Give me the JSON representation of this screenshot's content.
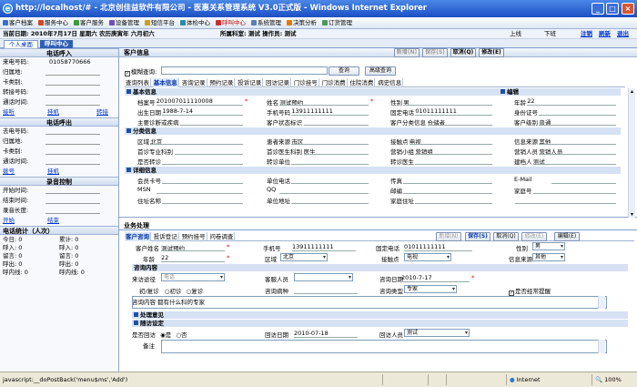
{
  "window": {
    "title": "http://localhost/# - 北京创佳益软件有限公司 - 医惠关系管理系统 V3.0正式版 - Windows Internet Explorer"
  },
  "menu": {
    "items": [
      {
        "label": "客户档案",
        "color": "#3a6ed0"
      },
      {
        "label": "服务中心",
        "color": "#d2462e"
      },
      {
        "label": "客户服务",
        "color": "#3a9a3a"
      },
      {
        "label": "设备管理",
        "color": "#6b4fc0"
      },
      {
        "label": "短信平台",
        "color": "#c9a020"
      },
      {
        "label": "体检中心",
        "color": "#2a8aa8"
      },
      {
        "label": "呼叫中心",
        "color": "#c83030"
      },
      {
        "label": "系统管理",
        "color": "#5a7fb0"
      },
      {
        "label": "决策分析",
        "color": "#e07a10"
      },
      {
        "label": "订货管理",
        "color": "#4a9a5a"
      }
    ]
  },
  "info": {
    "date_text": "当前日期: 2010年7月17日 星期六 农历庚寅年 六月初六",
    "org_text": "所属科室: 测试 操作员: 测试",
    "up": "上线",
    "down": "下班",
    "logout": "注销",
    "refresh": "刷新",
    "exit": "退出"
  },
  "tabs": {
    "home": "个人桌面",
    "call": "呼叫中心"
  },
  "left": {
    "call_in": {
      "title": "电话呼入",
      "caller_label": "来电号码:",
      "caller_value": "01058770666",
      "area_label": "归属地:",
      "card_label": "卡类别:",
      "transfer_label": "转接号码:",
      "time_label": "通话时间:",
      "answer": "接听",
      "hangup": "挂机",
      "transfer": "转接"
    },
    "call_out": {
      "title": "电话呼出",
      "number_label": "去电号码:",
      "area_label": "归属地:",
      "card_label": "卡类别:",
      "time_label": "通话时间:",
      "dial": "拨号",
      "hangup": "挂机"
    },
    "record": {
      "title": "录音控制",
      "start_label": "开始时间:",
      "end_label": "结束时间:",
      "length_label": "录音长度:",
      "start": "开始",
      "stop": "结束"
    },
    "stats": {
      "title": "电话统计（人次）",
      "rows": [
        [
          "今日: 0",
          "累计: 0"
        ],
        [
          "呼入: 0",
          "呼入: 0"
        ],
        [
          "留言: 0",
          "留言: 0"
        ],
        [
          "呼出: 0",
          "呼出: 0"
        ],
        [
          "呼内线: 0",
          "呼内线: 0"
        ]
      ]
    }
  },
  "customer": {
    "section_title": "客户信息",
    "buttons": {
      "add": "新增(N)",
      "save": "保存(S)",
      "cancel": "取消(Q)",
      "edit": "修改(E)"
    },
    "fuzzy_label": "模糊查询:",
    "query": "查询",
    "advanced": "高级查询",
    "subtabs": [
      "查询列表",
      "基本信息",
      "咨询记录",
      "预约记录",
      "投诉记录",
      "回访记录",
      "门诊挂号",
      "门诊消费",
      "住院消费",
      "病史信息"
    ],
    "basic_group": "基本信息",
    "edit_link": "编辑",
    "rows": [
      [
        {
          "k": "档案号",
          "v": "201007011110008"
        },
        {
          "k": "姓名",
          "v": "测试预约"
        },
        {
          "k": "性别",
          "v": "男"
        },
        {
          "k": "年龄",
          "v": "22"
        }
      ],
      [
        {
          "k": "出生日期",
          "v": "1988-7-14"
        },
        {
          "k": "手机号码",
          "v": "13911111111"
        },
        {
          "k": "固定电话",
          "v": "01011111111"
        },
        {
          "k": "身份证号",
          "v": ""
        }
      ],
      [
        {
          "k": "主要诊断或疾病",
          "v": ""
        },
        {
          "k": "客户状态标识",
          "v": ""
        },
        {
          "k": "客户分类信息",
          "v": "仓储者"
        },
        {
          "k": "客户级别",
          "v": "普通"
        }
      ]
    ],
    "channel_group": "分类信息",
    "channel_rows": [
      [
        {
          "k": "区域",
          "v": "北京"
        },
        {
          "k": "患者来源",
          "v": "市区"
        },
        {
          "k": "接触点",
          "v": "电视"
        },
        {
          "k": "信息来源",
          "v": "其他"
        }
      ],
      [
        {
          "k": "首诊专业科别",
          "v": ""
        },
        {
          "k": "首诊医生科别",
          "v": "医生"
        },
        {
          "k": "营销小组",
          "v": "营销组"
        },
        {
          "k": "营销人员",
          "v": "营销人员"
        }
      ],
      [
        {
          "k": "是否转诊",
          "v": ""
        },
        {
          "k": "转诊单位",
          "v": ""
        },
        {
          "k": "转诊医生",
          "v": ""
        },
        {
          "k": "建档人",
          "v": "测试"
        }
      ]
    ],
    "detail_group": "详细信息",
    "detail_rows": [
      [
        {
          "k": "会员卡号",
          "v": ""
        },
        {
          "k": "单位电话",
          "v": ""
        },
        {
          "k": "传真",
          "v": ""
        },
        {
          "k": "E-Mail",
          "v": ""
        }
      ],
      [
        {
          "k": "MSN",
          "v": ""
        },
        {
          "k": "QQ",
          "v": ""
        },
        {
          "k": "邮编",
          "v": ""
        },
        {
          "k": "家庭号",
          "v": ""
        }
      ],
      [
        {
          "k": "住址名称",
          "v": ""
        },
        {
          "k": "单位地址",
          "v": ""
        },
        {
          "k": "家庭住址",
          "v": ""
        },
        {
          "k": "",
          "v": ""
        }
      ]
    ]
  },
  "business": {
    "section_title": "业务处理",
    "subtabs": [
      "客户咨询",
      "投诉登记",
      "预约挂号",
      "问卷调查"
    ],
    "buttons": {
      "add": "新增(N)",
      "save": "保存(S)",
      "cancel": "取消(Q)",
      "edit": "修改(E)",
      "edit2": "编辑(E)"
    },
    "name_label": "客户姓名",
    "name_value": "测试预约",
    "phone_label": "手机号",
    "phone_value": "13911111111",
    "tel_label": "固定电话",
    "tel_value": "01011111111",
    "gender_label": "性别",
    "gender_value": "男",
    "age_label": "年龄",
    "age_value": "22",
    "area_label": "区域",
    "area_value": "北京",
    "contact_label": "接触点",
    "contact_value": "电视",
    "source_label": "信息来源",
    "source_value": "其他",
    "consult_group": "咨询内容",
    "way_label": "来访途径",
    "way_value": "电话",
    "service_label": "客服人员",
    "service_value": "",
    "date_label": "咨询日期",
    "date_value": "2010-7-17",
    "first_label": "初/复诊",
    "first_opt": "初诊",
    "repeat_opt": "复诊",
    "disease_label": "咨询病种",
    "disease_value": "",
    "type_label": "咨询类型",
    "type_value": "专家",
    "trace_label": "是否经常提醒",
    "content_label": "咨询内容",
    "content_value": "都有什么科的专家",
    "handle_group": "处理意见",
    "track_group": "随访设定",
    "visit_label": "是否回访",
    "yes": "是",
    "no": "否",
    "visit_date_label": "回访日期",
    "visit_date_value": "2010-07-18",
    "visitor_label": "回访人员",
    "visitor_value": "测试",
    "remark_label": "备注"
  },
  "status": {
    "text": "javascript:__doPostBack('menu$ms','Add')",
    "zone": "Internet",
    "zoom": "100%"
  }
}
